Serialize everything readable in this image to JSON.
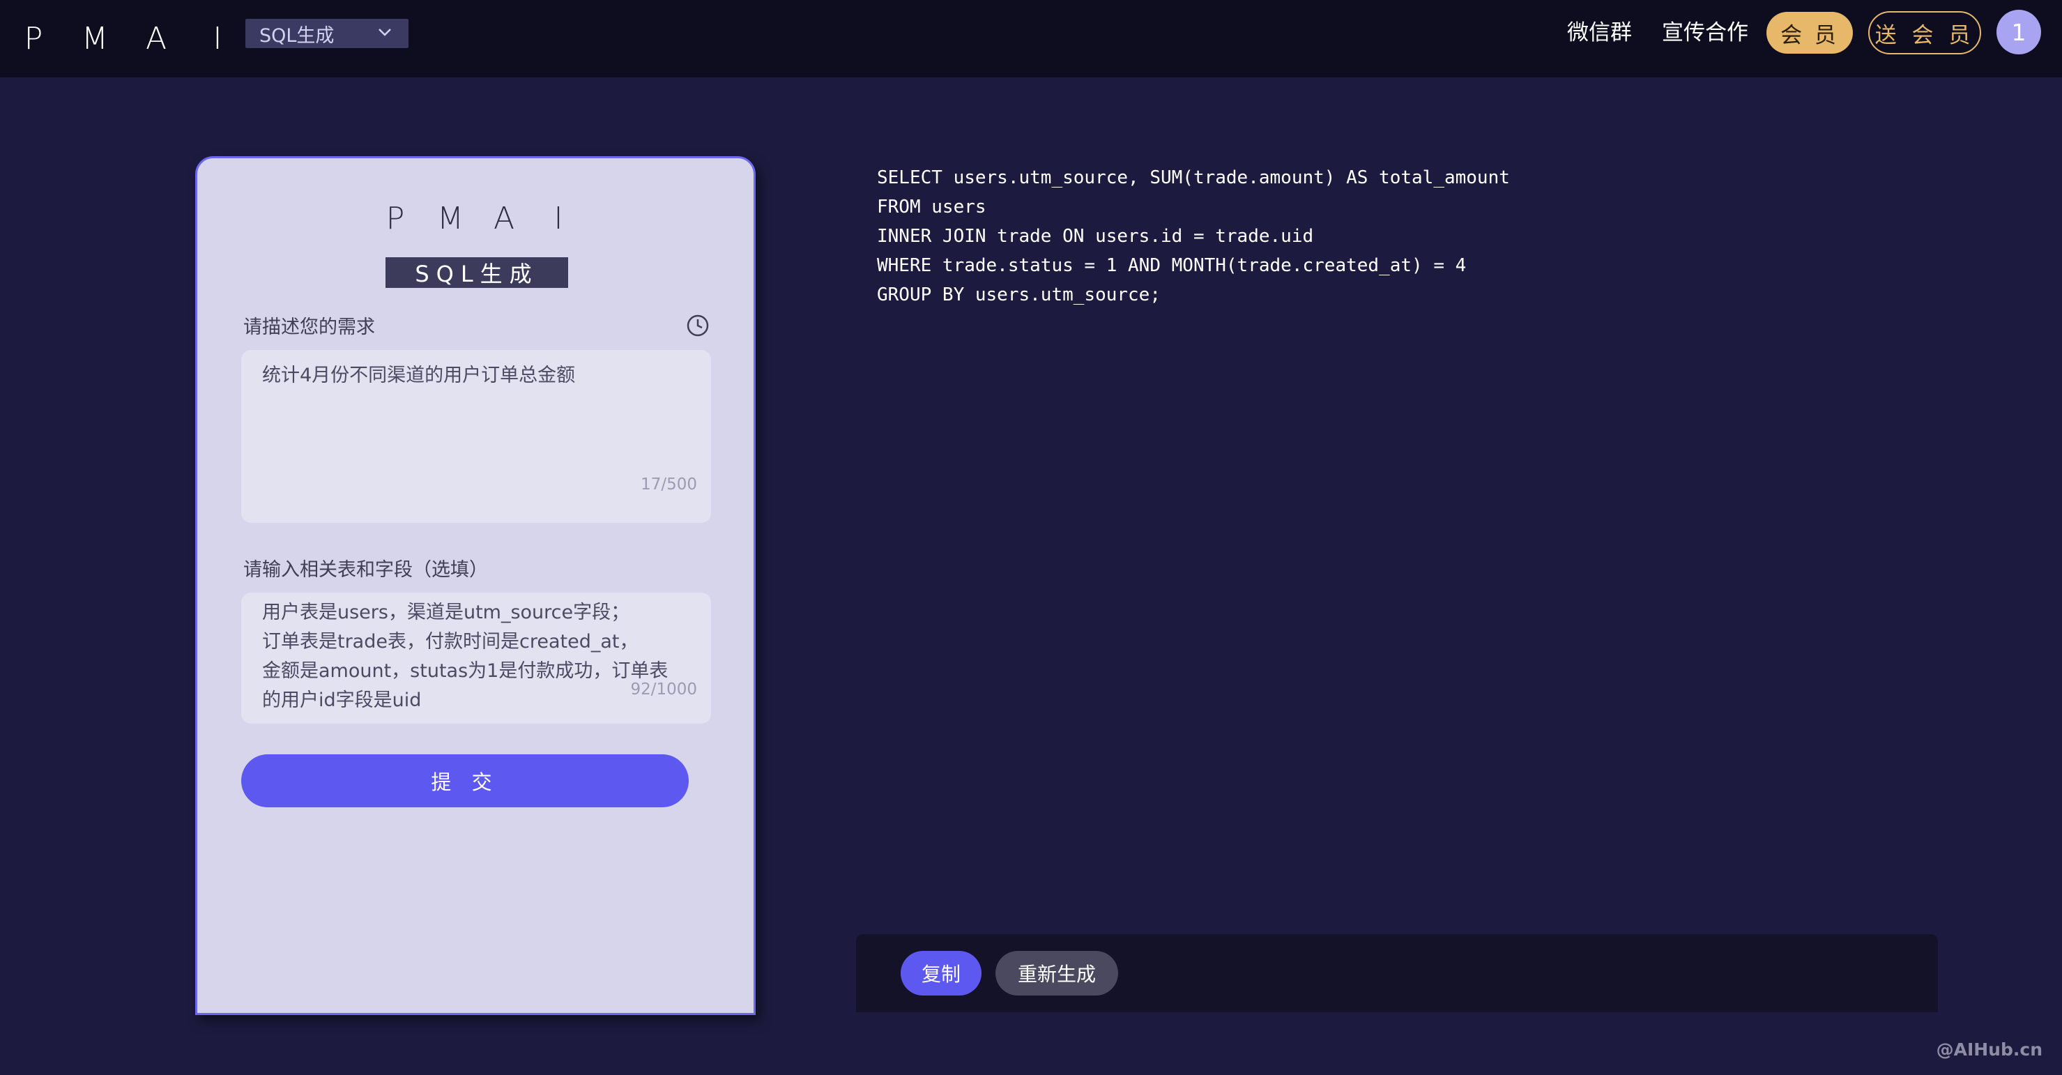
{
  "header": {
    "logo_letters": [
      "P",
      "M",
      "A",
      "I"
    ],
    "mode_select": "SQL生成",
    "nav": {
      "wechat_group": "微信群",
      "promo": "宣传合作",
      "vip": "会 员",
      "gift_vip": "送 会 员"
    },
    "avatar_text": "1"
  },
  "card": {
    "logo_letters": [
      "P",
      "M",
      "A",
      "I"
    ],
    "badge": "SQL生成",
    "requirement": {
      "label": "请描述您的需求",
      "value": "统计4月份不同渠道的用户订单总金额",
      "counter": "17/500"
    },
    "tables": {
      "label": "请输入相关表和字段（选填）",
      "value": "用户表是users，渠道是utm_source字段；\n订单表是trade表，付款时间是created_at，\n金额是amount，stutas为1是付款成功，订单表\n的用户id字段是uid",
      "counter": "92/1000"
    },
    "submit": "提 交"
  },
  "result": {
    "sql": "SELECT users.utm_source, SUM(trade.amount) AS total_amount\nFROM users\nINNER JOIN trade ON users.id = trade.uid\nWHERE trade.status = 1 AND MONTH(trade.created_at) = 4\nGROUP BY users.utm_source;",
    "copy": "复制",
    "regenerate": "重新生成"
  },
  "watermark": "@AIHub.cn",
  "colors": {
    "background": "#1c1b3f",
    "topbar": "#0e0d20",
    "accent": "#5d58f0",
    "gold": "#e8b86a",
    "card": "#d6d5ec"
  }
}
